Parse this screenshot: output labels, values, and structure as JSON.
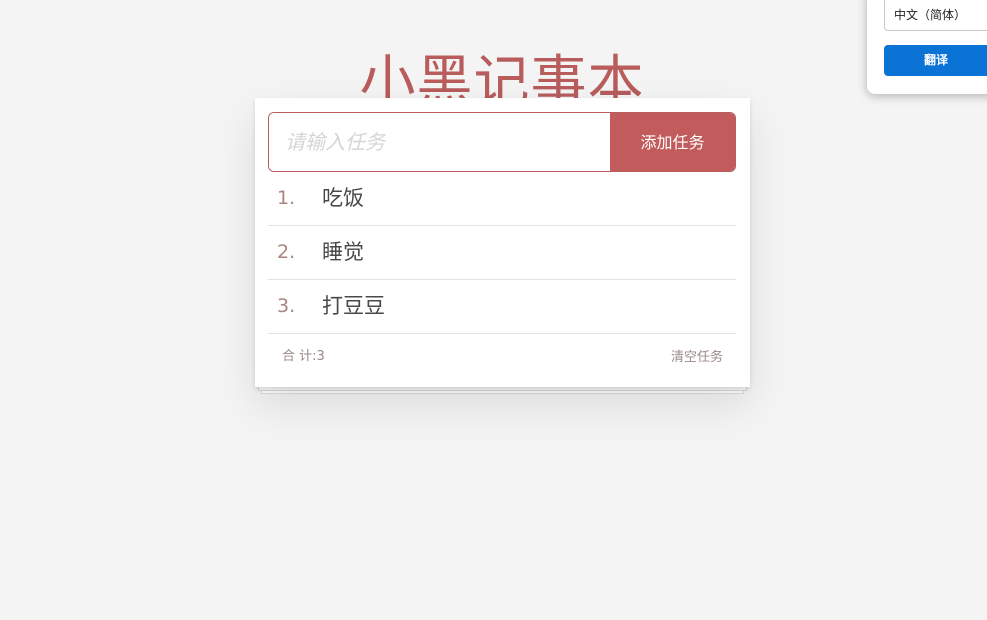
{
  "app": {
    "title": "小黑记事本"
  },
  "input": {
    "placeholder": "请输入任务",
    "value": "",
    "add_label": "添加任务"
  },
  "tasks": [
    {
      "index": "1.",
      "text": "吃饭"
    },
    {
      "index": "2.",
      "text": "睡觉"
    },
    {
      "index": "3.",
      "text": "打豆豆"
    }
  ],
  "footer": {
    "count_label": "合 计:3",
    "clear_label": "清空任务"
  },
  "translate_popup": {
    "language": "中文（简体）",
    "button_label": "翻译"
  },
  "colors": {
    "accent": "#c25b5b",
    "title": "#b85c5c",
    "background": "#f4f4f4",
    "translate_button": "#0b73d6"
  }
}
